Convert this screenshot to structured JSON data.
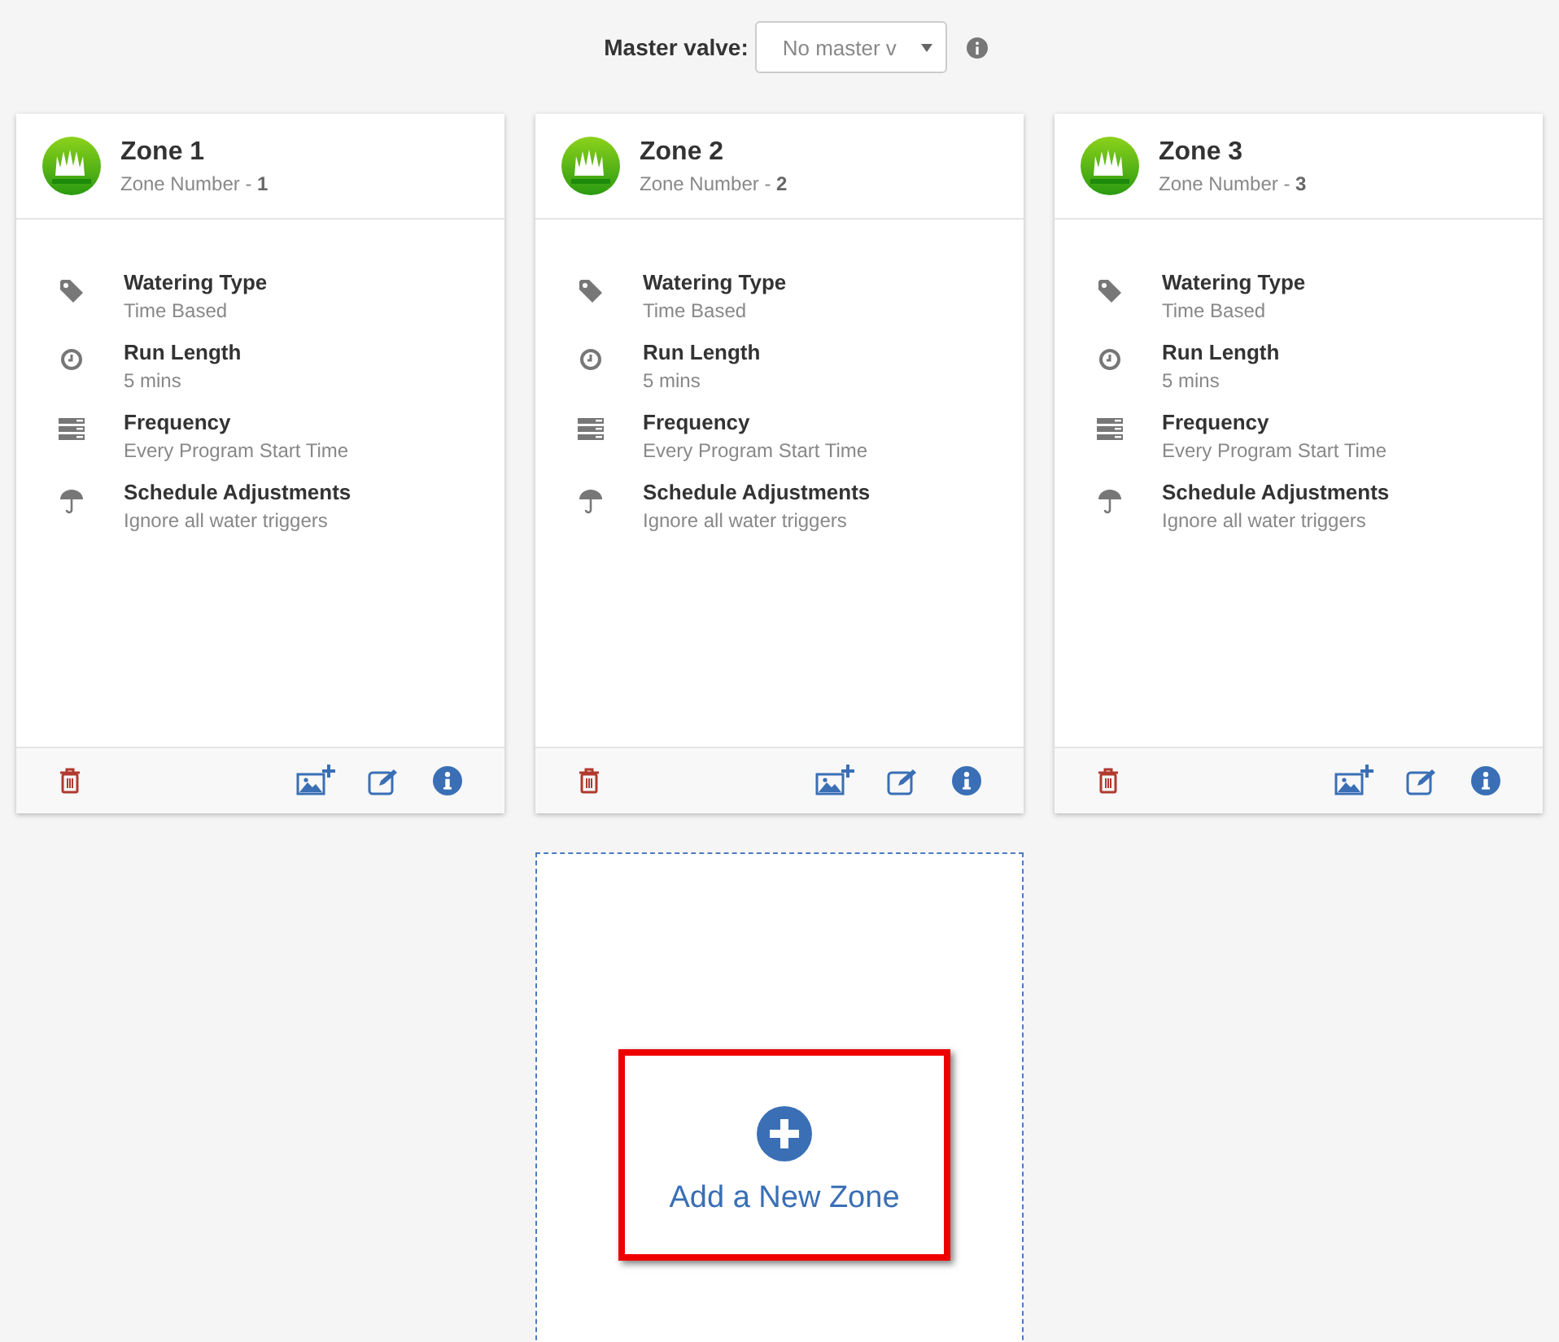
{
  "master_valve": {
    "label": "Master valve:",
    "value": "No master v"
  },
  "zones": [
    {
      "title": "Zone 1",
      "number": "Zone Number - **1**",
      "details": [
        {
          "kind": "tag",
          "label": "Watering Type",
          "value": "Time Based"
        },
        {
          "kind": "clock",
          "label": "Run Length",
          "value": "5 mins"
        },
        {
          "kind": "list",
          "label": "Frequency",
          "value": "Every Program Start Time"
        },
        {
          "kind": "umbrella",
          "label": "Schedule Adjustments",
          "value": "Ignore all water triggers"
        }
      ]
    },
    {
      "title": "Zone 2",
      "number": "Zone Number - **2**",
      "details": [
        {
          "kind": "tag",
          "label": "Watering Type",
          "value": "Time Based"
        },
        {
          "kind": "clock",
          "label": "Run Length",
          "value": "5 mins"
        },
        {
          "kind": "list",
          "label": "Frequency",
          "value": "Every Program Start Time"
        },
        {
          "kind": "umbrella",
          "label": "Schedule Adjustments",
          "value": "Ignore all water triggers"
        }
      ]
    },
    {
      "title": "Zone 3",
      "number": "Zone Number - **3**",
      "details": [
        {
          "kind": "tag",
          "label": "Watering Type",
          "value": "Time Based"
        },
        {
          "kind": "clock",
          "label": "Run Length",
          "value": "5 mins"
        },
        {
          "kind": "list",
          "label": "Frequency",
          "value": "Every Program Start Time"
        },
        {
          "kind": "umbrella",
          "label": "Schedule Adjustments",
          "value": "Ignore all water triggers"
        }
      ]
    }
  ],
  "add_zone": {
    "label": "Add a New Zone"
  }
}
